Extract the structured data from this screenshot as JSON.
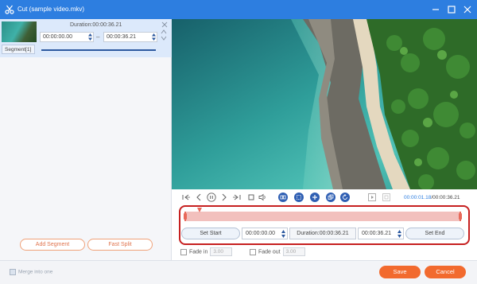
{
  "window": {
    "title": "Cut (sample video.mkv)",
    "controls": [
      "minimize-icon",
      "maximize-icon",
      "close-icon"
    ]
  },
  "segment_panel": {
    "segment_label": "Segment[1]",
    "duration_text": "Duration:00:00:36.21",
    "start_time": "00:00:00.00",
    "separator": "–",
    "end_time": "00:00:36.21",
    "add_segment_label": "Add Segment",
    "fast_split_label": "Fast Split"
  },
  "player": {
    "current_time": "00:00:01.18",
    "total_time": "/00:00:36.21",
    "icons": [
      "jump-start-icon",
      "prev-frame-icon",
      "pause-icon",
      "next-frame-icon",
      "jump-end-icon",
      "stop-icon",
      "volume-icon",
      "segment-copy-icon",
      "cut-icon",
      "add-icon",
      "duplicate-icon",
      "rotate-icon",
      "play-selection-icon",
      "fullscreen-icon"
    ]
  },
  "cut_controls": {
    "set_start_label": "Set Start",
    "start_value": "00:00:00.00",
    "duration_value": "Duration:00:00:36.21",
    "end_value": "00:00:36.21",
    "set_end_label": "Set End",
    "fade_in_label": "Fade in",
    "fade_in_value": "3.00",
    "fade_out_label": "Fade out",
    "fade_out_value": "3.00"
  },
  "footer": {
    "merge_label": "Merge into one",
    "save_label": "Save",
    "cancel_label": "Cancel"
  },
  "colors": {
    "accent": "#2d7ee0",
    "orange": "#f26a2e",
    "highlight_border": "#c62020",
    "timeline_fill": "#f2c0bd"
  }
}
